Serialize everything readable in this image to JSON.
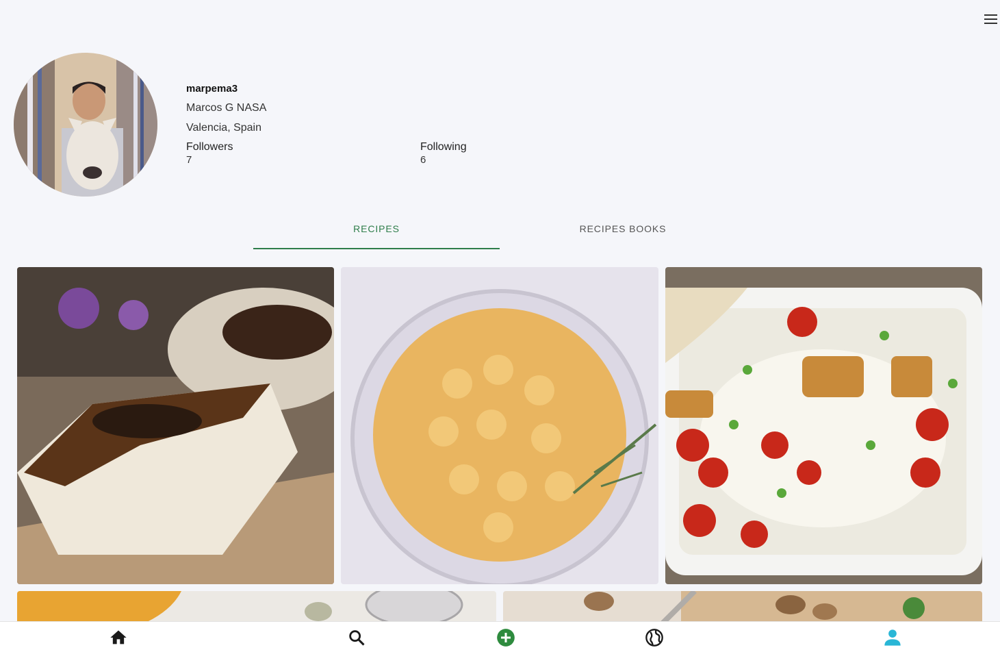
{
  "header": {
    "menu_icon": "hamburger-menu-icon"
  },
  "profile": {
    "username": "marpema3",
    "full_name": "Marcos G NASA",
    "location": "Valencia, Spain",
    "followers_label": "Followers",
    "followers_count": "7",
    "following_label": "Following",
    "following_count": "6"
  },
  "tabs": [
    {
      "label": "RECIPES",
      "active": true
    },
    {
      "label": "RECIPES BOOKS",
      "active": false
    }
  ],
  "recipes": [
    {
      "image": "burnt cheesecake slice"
    },
    {
      "image": "macaroni and cheese bowl"
    },
    {
      "image": "baked fish with tomatoes and peas"
    },
    {
      "image": "pumpkin soup"
    },
    {
      "image": "walnuts and herbs dish"
    }
  ],
  "bottom_nav": [
    {
      "icon": "home-icon"
    },
    {
      "icon": "search-icon"
    },
    {
      "icon": "add-circle-icon"
    },
    {
      "icon": "globe-icon"
    },
    {
      "icon": "profile-icon"
    }
  ],
  "colors": {
    "accent": "#2e7d4a",
    "profile_active": "#29b6d6",
    "background": "#f5f6fa"
  }
}
